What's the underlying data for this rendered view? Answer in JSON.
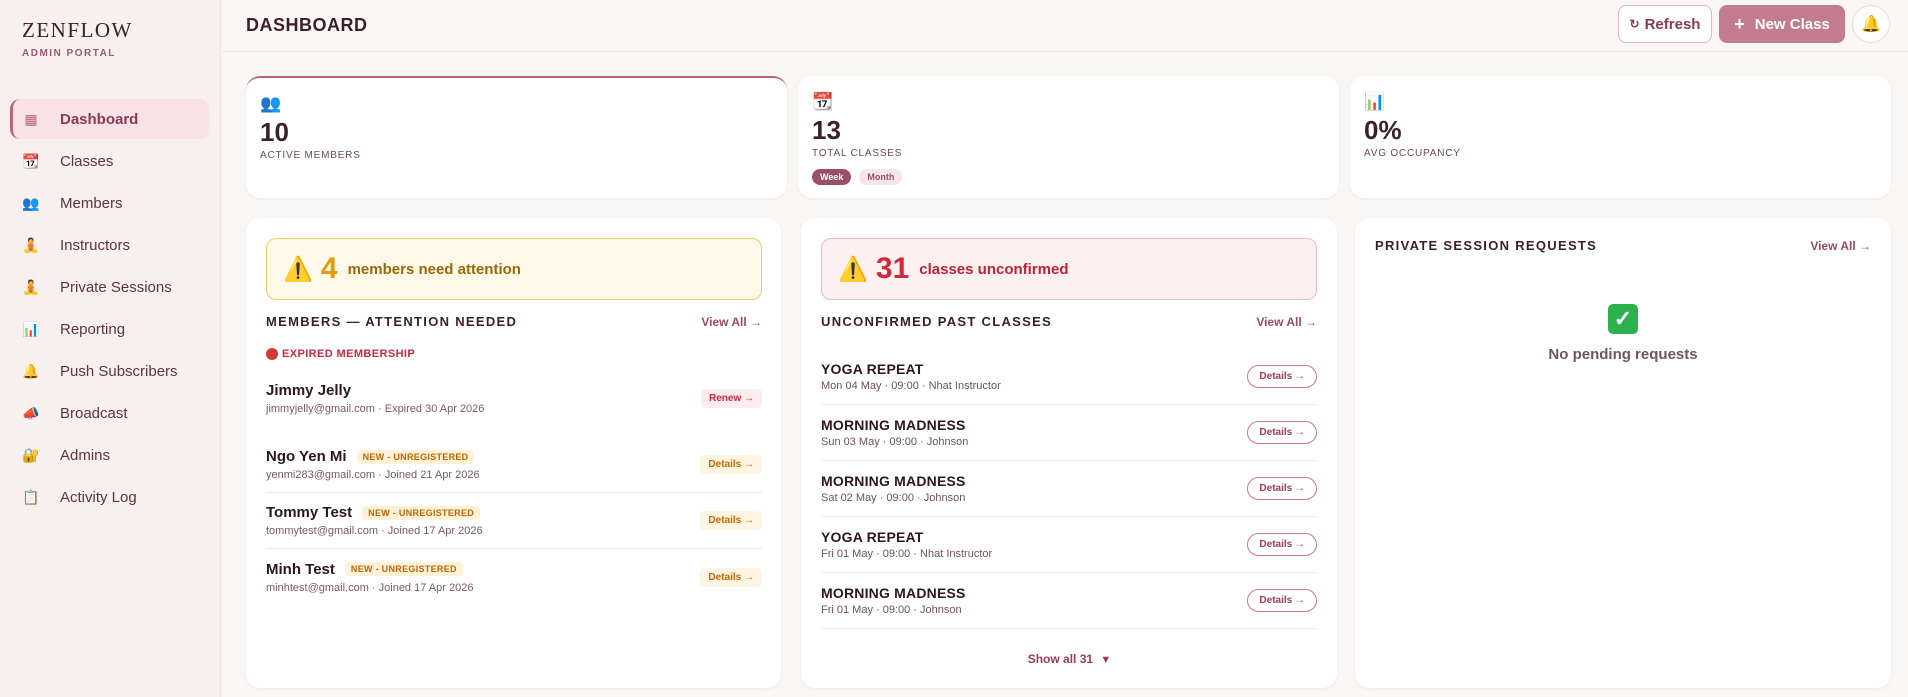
{
  "brand": {
    "name": "ZENFLOW",
    "subtitle": "ADMIN PORTAL"
  },
  "sidebar": {
    "items": [
      {
        "label": "Dashboard",
        "icon": "grid-icon",
        "glyph": "▦",
        "active": true
      },
      {
        "label": "Classes",
        "icon": "calendar-icon",
        "glyph": "📆"
      },
      {
        "label": "Members",
        "icon": "people-icon",
        "glyph": "👥"
      },
      {
        "label": "Instructors",
        "icon": "meditation-icon",
        "glyph": "🧘"
      },
      {
        "label": "Private Sessions",
        "icon": "meditation-icon",
        "glyph": "🧘"
      },
      {
        "label": "Reporting",
        "icon": "bar-chart-icon",
        "glyph": "📊"
      },
      {
        "label": "Push Subscribers",
        "icon": "bell-icon",
        "glyph": "🔔"
      },
      {
        "label": "Broadcast",
        "icon": "megaphone-icon",
        "glyph": "📣"
      },
      {
        "label": "Admins",
        "icon": "lock-icon",
        "glyph": "🔐"
      },
      {
        "label": "Activity Log",
        "icon": "clipboard-icon",
        "glyph": "📋"
      }
    ]
  },
  "header": {
    "title": "DASHBOARD",
    "refresh_label": "Refresh",
    "refresh_glyph": "↻",
    "new_class_label": "New Class",
    "new_glyph": "+",
    "bell_glyph": "🔔"
  },
  "stats": {
    "members": {
      "glyph": "👥",
      "value": "10",
      "label": "ACTIVE MEMBERS"
    },
    "classes": {
      "glyph": "📆",
      "value": "13",
      "label": "TOTAL CLASSES",
      "pill_week": "Week",
      "pill_month": "Month",
      "selected": "Week"
    },
    "occupancy": {
      "glyph": "📊",
      "value": "0%",
      "label": "AVG OCCUPANCY"
    }
  },
  "members_panel": {
    "alert_glyph": "⚠️",
    "alert_count": "4",
    "alert_text": "members need attention",
    "title": "MEMBERS — ATTENTION NEEDED",
    "view_all": "View All →",
    "expired_label": "EXPIRED MEMBERSHIP",
    "expired": [
      {
        "name": "Jimmy Jelly",
        "sub": "jimmyjelly@gmail.com · Expired 30 Apr 2026",
        "action": "Renew →"
      }
    ],
    "new_members": [
      {
        "name": "Ngo Yen Mi",
        "tag": "NEW - UNREGISTERED",
        "sub": "yenmi283@gmail.com · Joined 21 Apr 2026",
        "action": "Details →"
      },
      {
        "name": "Tommy Test",
        "tag": "NEW - UNREGISTERED",
        "sub": "tommytest@gmail.com · Joined 17 Apr 2026",
        "action": "Details →"
      },
      {
        "name": "Minh Test",
        "tag": "NEW - UNREGISTERED",
        "sub": "minhtest@gmail.com · Joined 17 Apr 2026",
        "action": "Details →"
      }
    ]
  },
  "classes_panel": {
    "alert_glyph": "⚠️",
    "alert_count": "31",
    "alert_text": "classes unconfirmed",
    "title": "UNCONFIRMED PAST CLASSES",
    "view_all": "View All →",
    "rows": [
      {
        "name": "YOGA REPEAT",
        "sub": "Mon 04 May · 09:00 · Nhat Instructor",
        "action": "Details →"
      },
      {
        "name": "MORNING MADNESS",
        "sub": "Sun 03 May · 09:00 · Johnson",
        "action": "Details →"
      },
      {
        "name": "MORNING MADNESS",
        "sub": "Sat 02 May · 09:00 · Johnson",
        "action": "Details →"
      },
      {
        "name": "YOGA REPEAT",
        "sub": "Fri 01 May · 09:00 · Nhat Instructor",
        "action": "Details →"
      },
      {
        "name": "MORNING MADNESS",
        "sub": "Fri 01 May · 09:00 · Johnson",
        "action": "Details →"
      }
    ],
    "show_all": "Show all 31",
    "show_all_glyph": "▼"
  },
  "private_panel": {
    "title": "PRIVATE SESSION REQUESTS",
    "view_all": "View All →",
    "check_glyph": "✓",
    "empty_text": "No pending requests"
  }
}
